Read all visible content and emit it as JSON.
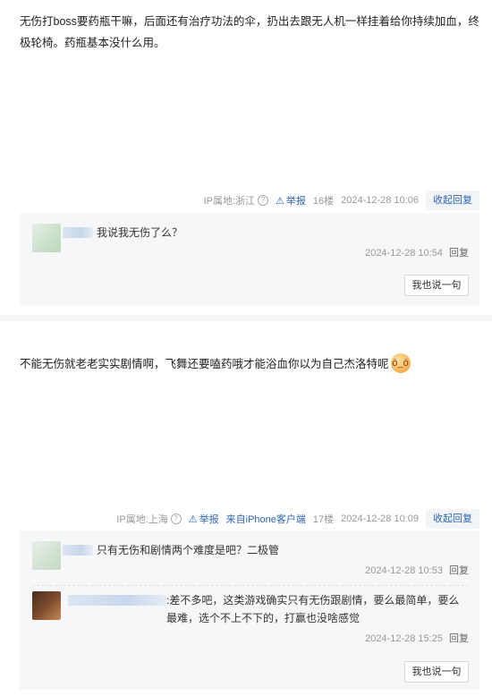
{
  "posts": [
    {
      "content": "无伤打boss要药瓶干嘛，后面还有治疗功法的伞，扔出去跟无人机一样挂着给你持续加血，终极轮椅。药瓶基本没什么用。",
      "ip": "IP属地:浙江",
      "report_label": "举报",
      "floor": "16楼",
      "time": "2024-12-28 10:06",
      "toggle_label": "收起回复",
      "replies": [
        {
          "text": "我说我无伤了么？",
          "time": "2024-12-28 10:54",
          "reply_label": "回复"
        }
      ],
      "say_label": "我也说一句"
    },
    {
      "content": "不能无伤就老老实实剧情啊，飞舞还要嗑药哦才能浴血你以为自己杰洛特呢",
      "ip": "IP属地:上海",
      "report_label": "举报",
      "client": "来自iPhone客户端",
      "floor": "17楼",
      "time": "2024-12-28 10:09",
      "toggle_label": "收起回复",
      "replies": [
        {
          "text": "只有无伤和剧情两个难度是吧？二极管",
          "time": "2024-12-28 10:53",
          "reply_label": "回复"
        },
        {
          "text": ":差不多吧，这类游戏确实只有无伤跟剧情，要么最简单，要么最难，选个不上不下的，打赢也没啥感觉",
          "time": "2024-12-28 15:25",
          "reply_label": "回复"
        }
      ],
      "say_label": "我也说一句"
    }
  ],
  "colors": {
    "link": "#2d64b3",
    "meta": "#999999",
    "reply_bg": "#f6f7f8"
  },
  "icons": {
    "help": "question-circle-icon",
    "report": "warning-triangle-icon",
    "emoji": "angry-face-emoji"
  }
}
